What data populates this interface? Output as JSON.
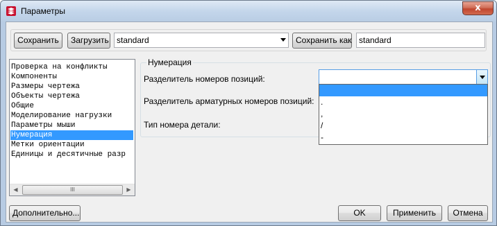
{
  "window": {
    "title": "Параметры",
    "close_label": "x"
  },
  "toolbar": {
    "save_label": "Сохранить",
    "load_label": "Загрузить",
    "preset_value": "standard",
    "save_as_label": "Сохранить как",
    "save_as_name": "standard"
  },
  "tree": {
    "items": [
      "Проверка на конфликты",
      "Компоненты",
      "Размеры чертежа",
      "Объекты чертежа",
      "Общие",
      "Моделирование нагрузки",
      "Параметры мыши",
      "Нумерация",
      "Метки ориентации",
      "Единицы и десятичные разр"
    ],
    "selected_index": 7,
    "scroll_thumb_grip": "III"
  },
  "numbering": {
    "group_title": "Нумерация",
    "position_separator_label": "Разделитель номеров позиций:",
    "rebar_separator_label": "Разделитель арматурных номеров позиций:",
    "part_number_type_label": "Тип номера детали:",
    "position_separator_value": "",
    "dropdown_options": [
      "",
      ".",
      ",",
      "/",
      "-"
    ],
    "dropdown_selected_index": 0
  },
  "footer": {
    "advanced_label": "Дополнительно...",
    "ok_label": "OK",
    "apply_label": "Применить",
    "cancel_label": "Отмена"
  },
  "colors": {
    "selection": "#3399ff",
    "close_button": "#c1462f",
    "title_bar": "#c4d6eb"
  },
  "icons": {
    "app": "app-logo-icon",
    "close": "close-icon",
    "combo": "chevron-down-icon"
  }
}
